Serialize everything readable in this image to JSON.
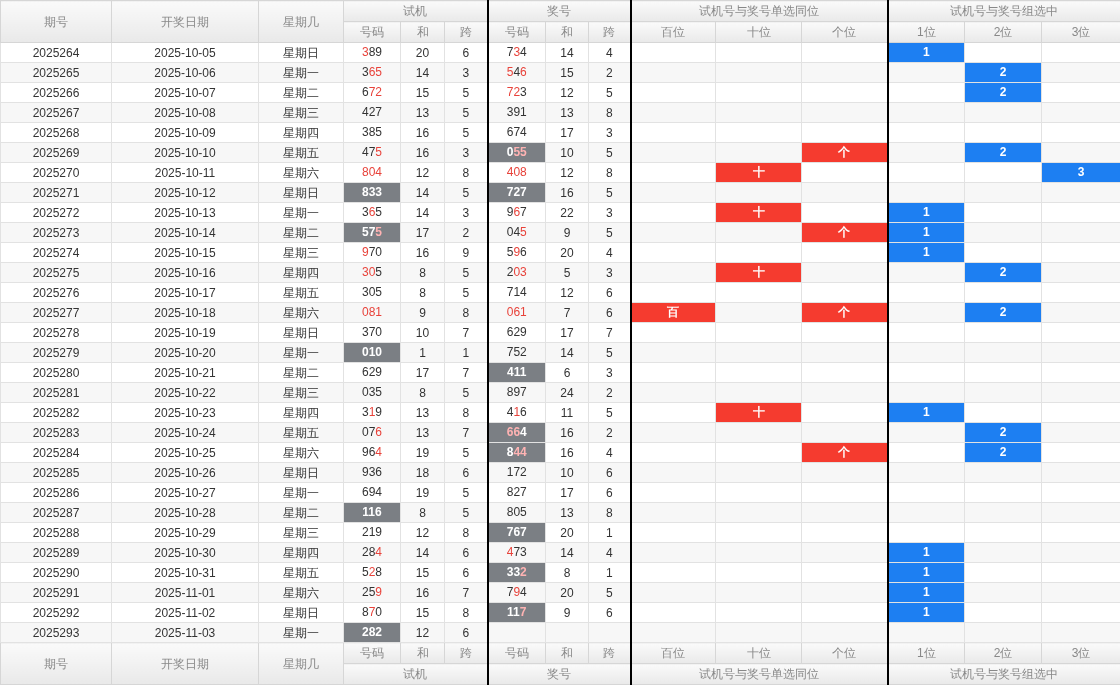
{
  "header": {
    "fixed": [
      "期号",
      "开奖日期",
      "星期几"
    ],
    "groups": [
      {
        "label": "试机",
        "subs": [
          "号码",
          "和",
          "跨"
        ]
      },
      {
        "label": "奖号",
        "subs": [
          "号码",
          "和",
          "跨"
        ]
      },
      {
        "label": "试机号与奖号单选同位",
        "subs": [
          "百位",
          "十位",
          "个位"
        ]
      },
      {
        "label": "试机号与奖号组选中",
        "subs": [
          "1位",
          "2位",
          "3位"
        ]
      }
    ]
  },
  "rows": [
    {
      "period": "2025264",
      "date": "2025-10-05",
      "weekday": "星期日",
      "trial": {
        "digits": [
          "3",
          "8",
          "9"
        ],
        "hits": [
          true,
          false,
          false
        ],
        "highlight": false
      },
      "trial_sum": "20",
      "trial_span": "6",
      "prize": {
        "digits": [
          "7",
          "3",
          "4"
        ],
        "hits": [
          false,
          true,
          false
        ],
        "highlight": false
      },
      "prize_sum": "14",
      "prize_span": "4",
      "group": {
        "first": "1"
      }
    },
    {
      "period": "2025265",
      "date": "2025-10-06",
      "weekday": "星期一",
      "trial": {
        "digits": [
          "3",
          "6",
          "5"
        ],
        "hits": [
          false,
          true,
          true
        ],
        "highlight": false
      },
      "trial_sum": "14",
      "trial_span": "3",
      "prize": {
        "digits": [
          "5",
          "4",
          "6"
        ],
        "hits": [
          true,
          false,
          true
        ],
        "highlight": false
      },
      "prize_sum": "15",
      "prize_span": "2",
      "group": {
        "second": "2"
      }
    },
    {
      "period": "2025266",
      "date": "2025-10-07",
      "weekday": "星期二",
      "trial": {
        "digits": [
          "6",
          "7",
          "2"
        ],
        "hits": [
          false,
          true,
          true
        ],
        "highlight": false
      },
      "trial_sum": "15",
      "trial_span": "5",
      "prize": {
        "digits": [
          "7",
          "2",
          "3"
        ],
        "hits": [
          true,
          true,
          false
        ],
        "highlight": false
      },
      "prize_sum": "12",
      "prize_span": "5",
      "group": {
        "second": "2"
      }
    },
    {
      "period": "2025267",
      "date": "2025-10-08",
      "weekday": "星期三",
      "trial": {
        "digits": [
          "4",
          "2",
          "7"
        ],
        "hits": [
          false,
          false,
          false
        ],
        "highlight": false
      },
      "trial_sum": "13",
      "trial_span": "5",
      "prize": {
        "digits": [
          "3",
          "9",
          "1"
        ],
        "hits": [
          false,
          false,
          false
        ],
        "highlight": false
      },
      "prize_sum": "13",
      "prize_span": "8"
    },
    {
      "period": "2025268",
      "date": "2025-10-09",
      "weekday": "星期四",
      "trial": {
        "digits": [
          "3",
          "8",
          "5"
        ],
        "hits": [
          false,
          false,
          false
        ],
        "highlight": false
      },
      "trial_sum": "16",
      "trial_span": "5",
      "prize": {
        "digits": [
          "6",
          "7",
          "4"
        ],
        "hits": [
          false,
          false,
          false
        ],
        "highlight": false
      },
      "prize_sum": "17",
      "prize_span": "3"
    },
    {
      "period": "2025269",
      "date": "2025-10-10",
      "weekday": "星期五",
      "trial": {
        "digits": [
          "4",
          "7",
          "5"
        ],
        "hits": [
          false,
          false,
          true
        ],
        "highlight": false
      },
      "trial_sum": "16",
      "trial_span": "3",
      "prize": {
        "digits": [
          "0",
          "5",
          "5"
        ],
        "hits": [
          false,
          true,
          true
        ],
        "highlight": true
      },
      "prize_sum": "10",
      "prize_span": "5",
      "single": {
        "ones": "个"
      },
      "group": {
        "second": "2"
      }
    },
    {
      "period": "2025270",
      "date": "2025-10-11",
      "weekday": "星期六",
      "trial": {
        "digits": [
          "8",
          "0",
          "4"
        ],
        "hits": [
          true,
          true,
          true
        ],
        "highlight": false
      },
      "trial_sum": "12",
      "trial_span": "8",
      "prize": {
        "digits": [
          "4",
          "0",
          "8"
        ],
        "hits": [
          true,
          true,
          true
        ],
        "highlight": false
      },
      "prize_sum": "12",
      "prize_span": "8",
      "single": {
        "tens": "十"
      },
      "group": {
        "third": "3"
      }
    },
    {
      "period": "2025271",
      "date": "2025-10-12",
      "weekday": "星期日",
      "trial": {
        "digits": [
          "8",
          "3",
          "3"
        ],
        "hits": [
          false,
          false,
          false
        ],
        "highlight": true
      },
      "trial_sum": "14",
      "trial_span": "5",
      "prize": {
        "digits": [
          "7",
          "2",
          "7"
        ],
        "hits": [
          false,
          false,
          false
        ],
        "highlight": true
      },
      "prize_sum": "16",
      "prize_span": "5"
    },
    {
      "period": "2025272",
      "date": "2025-10-13",
      "weekday": "星期一",
      "trial": {
        "digits": [
          "3",
          "6",
          "5"
        ],
        "hits": [
          false,
          true,
          false
        ],
        "highlight": false
      },
      "trial_sum": "14",
      "trial_span": "3",
      "prize": {
        "digits": [
          "9",
          "6",
          "7"
        ],
        "hits": [
          false,
          true,
          false
        ],
        "highlight": false
      },
      "prize_sum": "22",
      "prize_span": "3",
      "single": {
        "tens": "十"
      },
      "group": {
        "first": "1"
      }
    },
    {
      "period": "2025273",
      "date": "2025-10-14",
      "weekday": "星期二",
      "trial": {
        "digits": [
          "5",
          "7",
          "5"
        ],
        "hits": [
          false,
          false,
          true
        ],
        "highlight": true
      },
      "trial_sum": "17",
      "trial_span": "2",
      "prize": {
        "digits": [
          "0",
          "4",
          "5"
        ],
        "hits": [
          false,
          false,
          true
        ],
        "highlight": false
      },
      "prize_sum": "9",
      "prize_span": "5",
      "single": {
        "ones": "个"
      },
      "group": {
        "first": "1"
      }
    },
    {
      "period": "2025274",
      "date": "2025-10-15",
      "weekday": "星期三",
      "trial": {
        "digits": [
          "9",
          "7",
          "0"
        ],
        "hits": [
          true,
          false,
          false
        ],
        "highlight": false
      },
      "trial_sum": "16",
      "trial_span": "9",
      "prize": {
        "digits": [
          "5",
          "9",
          "6"
        ],
        "hits": [
          false,
          true,
          false
        ],
        "highlight": false
      },
      "prize_sum": "20",
      "prize_span": "4",
      "group": {
        "first": "1"
      }
    },
    {
      "period": "2025275",
      "date": "2025-10-16",
      "weekday": "星期四",
      "trial": {
        "digits": [
          "3",
          "0",
          "5"
        ],
        "hits": [
          true,
          true,
          false
        ],
        "highlight": false
      },
      "trial_sum": "8",
      "trial_span": "5",
      "prize": {
        "digits": [
          "2",
          "0",
          "3"
        ],
        "hits": [
          false,
          true,
          true
        ],
        "highlight": false
      },
      "prize_sum": "5",
      "prize_span": "3",
      "single": {
        "tens": "十"
      },
      "group": {
        "second": "2"
      }
    },
    {
      "period": "2025276",
      "date": "2025-10-17",
      "weekday": "星期五",
      "trial": {
        "digits": [
          "3",
          "0",
          "5"
        ],
        "hits": [
          false,
          false,
          false
        ],
        "highlight": false
      },
      "trial_sum": "8",
      "trial_span": "5",
      "prize": {
        "digits": [
          "7",
          "1",
          "4"
        ],
        "hits": [
          false,
          false,
          false
        ],
        "highlight": false
      },
      "prize_sum": "12",
      "prize_span": "6"
    },
    {
      "period": "2025277",
      "date": "2025-10-18",
      "weekday": "星期六",
      "trial": {
        "digits": [
          "0",
          "8",
          "1"
        ],
        "hits": [
          true,
          true,
          true
        ],
        "highlight": false
      },
      "trial_sum": "9",
      "trial_span": "8",
      "prize": {
        "digits": [
          "0",
          "6",
          "1"
        ],
        "hits": [
          true,
          true,
          true
        ],
        "highlight": false
      },
      "prize_sum": "7",
      "prize_span": "6",
      "single": {
        "hundreds": "百",
        "ones": "个"
      },
      "group": {
        "second": "2"
      }
    },
    {
      "period": "2025278",
      "date": "2025-10-19",
      "weekday": "星期日",
      "trial": {
        "digits": [
          "3",
          "7",
          "0"
        ],
        "hits": [
          false,
          false,
          false
        ],
        "highlight": false
      },
      "trial_sum": "10",
      "trial_span": "7",
      "prize": {
        "digits": [
          "6",
          "2",
          "9"
        ],
        "hits": [
          false,
          false,
          false
        ],
        "highlight": false
      },
      "prize_sum": "17",
      "prize_span": "7"
    },
    {
      "period": "2025279",
      "date": "2025-10-20",
      "weekday": "星期一",
      "trial": {
        "digits": [
          "0",
          "1",
          "0"
        ],
        "hits": [
          false,
          false,
          false
        ],
        "highlight": true
      },
      "trial_sum": "1",
      "trial_span": "1",
      "prize": {
        "digits": [
          "7",
          "5",
          "2"
        ],
        "hits": [
          false,
          false,
          false
        ],
        "highlight": false
      },
      "prize_sum": "14",
      "prize_span": "5"
    },
    {
      "period": "2025280",
      "date": "2025-10-21",
      "weekday": "星期二",
      "trial": {
        "digits": [
          "6",
          "2",
          "9"
        ],
        "hits": [
          false,
          false,
          false
        ],
        "highlight": false
      },
      "trial_sum": "17",
      "trial_span": "7",
      "prize": {
        "digits": [
          "4",
          "1",
          "1"
        ],
        "hits": [
          false,
          false,
          false
        ],
        "highlight": true
      },
      "prize_sum": "6",
      "prize_span": "3"
    },
    {
      "period": "2025281",
      "date": "2025-10-22",
      "weekday": "星期三",
      "trial": {
        "digits": [
          "0",
          "3",
          "5"
        ],
        "hits": [
          false,
          false,
          false
        ],
        "highlight": false
      },
      "trial_sum": "8",
      "trial_span": "5",
      "prize": {
        "digits": [
          "8",
          "9",
          "7"
        ],
        "hits": [
          false,
          false,
          false
        ],
        "highlight": false
      },
      "prize_sum": "24",
      "prize_span": "2"
    },
    {
      "period": "2025282",
      "date": "2025-10-23",
      "weekday": "星期四",
      "trial": {
        "digits": [
          "3",
          "1",
          "9"
        ],
        "hits": [
          false,
          true,
          false
        ],
        "highlight": false
      },
      "trial_sum": "13",
      "trial_span": "8",
      "prize": {
        "digits": [
          "4",
          "1",
          "6"
        ],
        "hits": [
          false,
          true,
          false
        ],
        "highlight": false
      },
      "prize_sum": "11",
      "prize_span": "5",
      "single": {
        "tens": "十"
      },
      "group": {
        "first": "1"
      }
    },
    {
      "period": "2025283",
      "date": "2025-10-24",
      "weekday": "星期五",
      "trial": {
        "digits": [
          "0",
          "7",
          "6"
        ],
        "hits": [
          false,
          false,
          true
        ],
        "highlight": false
      },
      "trial_sum": "13",
      "trial_span": "7",
      "prize": {
        "digits": [
          "6",
          "6",
          "4"
        ],
        "hits": [
          true,
          true,
          false
        ],
        "highlight": true
      },
      "prize_sum": "16",
      "prize_span": "2",
      "group": {
        "second": "2"
      }
    },
    {
      "period": "2025284",
      "date": "2025-10-25",
      "weekday": "星期六",
      "trial": {
        "digits": [
          "9",
          "6",
          "4"
        ],
        "hits": [
          false,
          false,
          true
        ],
        "highlight": false
      },
      "trial_sum": "19",
      "trial_span": "5",
      "prize": {
        "digits": [
          "8",
          "4",
          "4"
        ],
        "hits": [
          false,
          true,
          true
        ],
        "highlight": true
      },
      "prize_sum": "16",
      "prize_span": "4",
      "single": {
        "ones": "个"
      },
      "group": {
        "second": "2"
      }
    },
    {
      "period": "2025285",
      "date": "2025-10-26",
      "weekday": "星期日",
      "trial": {
        "digits": [
          "9",
          "3",
          "6"
        ],
        "hits": [
          false,
          false,
          false
        ],
        "highlight": false
      },
      "trial_sum": "18",
      "trial_span": "6",
      "prize": {
        "digits": [
          "1",
          "7",
          "2"
        ],
        "hits": [
          false,
          false,
          false
        ],
        "highlight": false
      },
      "prize_sum": "10",
      "prize_span": "6"
    },
    {
      "period": "2025286",
      "date": "2025-10-27",
      "weekday": "星期一",
      "trial": {
        "digits": [
          "6",
          "9",
          "4"
        ],
        "hits": [
          false,
          false,
          false
        ],
        "highlight": false
      },
      "trial_sum": "19",
      "trial_span": "5",
      "prize": {
        "digits": [
          "8",
          "2",
          "7"
        ],
        "hits": [
          false,
          false,
          false
        ],
        "highlight": false
      },
      "prize_sum": "17",
      "prize_span": "6"
    },
    {
      "period": "2025287",
      "date": "2025-10-28",
      "weekday": "星期二",
      "trial": {
        "digits": [
          "1",
          "1",
          "6"
        ],
        "hits": [
          false,
          false,
          false
        ],
        "highlight": true
      },
      "trial_sum": "8",
      "trial_span": "5",
      "prize": {
        "digits": [
          "8",
          "0",
          "5"
        ],
        "hits": [
          false,
          false,
          false
        ],
        "highlight": false
      },
      "prize_sum": "13",
      "prize_span": "8"
    },
    {
      "period": "2025288",
      "date": "2025-10-29",
      "weekday": "星期三",
      "trial": {
        "digits": [
          "2",
          "1",
          "9"
        ],
        "hits": [
          false,
          false,
          false
        ],
        "highlight": false
      },
      "trial_sum": "12",
      "trial_span": "8",
      "prize": {
        "digits": [
          "7",
          "6",
          "7"
        ],
        "hits": [
          false,
          false,
          false
        ],
        "highlight": true
      },
      "prize_sum": "20",
      "prize_span": "1"
    },
    {
      "period": "2025289",
      "date": "2025-10-30",
      "weekday": "星期四",
      "trial": {
        "digits": [
          "2",
          "8",
          "4"
        ],
        "hits": [
          false,
          false,
          true
        ],
        "highlight": false
      },
      "trial_sum": "14",
      "trial_span": "6",
      "prize": {
        "digits": [
          "4",
          "7",
          "3"
        ],
        "hits": [
          true,
          false,
          false
        ],
        "highlight": false
      },
      "prize_sum": "14",
      "prize_span": "4",
      "group": {
        "first": "1"
      }
    },
    {
      "period": "2025290",
      "date": "2025-10-31",
      "weekday": "星期五",
      "trial": {
        "digits": [
          "5",
          "2",
          "8"
        ],
        "hits": [
          false,
          true,
          false
        ],
        "highlight": false
      },
      "trial_sum": "15",
      "trial_span": "6",
      "prize": {
        "digits": [
          "3",
          "3",
          "2"
        ],
        "hits": [
          false,
          false,
          true
        ],
        "highlight": true
      },
      "prize_sum": "8",
      "prize_span": "1",
      "group": {
        "first": "1"
      }
    },
    {
      "period": "2025291",
      "date": "2025-11-01",
      "weekday": "星期六",
      "trial": {
        "digits": [
          "2",
          "5",
          "9"
        ],
        "hits": [
          false,
          false,
          true
        ],
        "highlight": false
      },
      "trial_sum": "16",
      "trial_span": "7",
      "prize": {
        "digits": [
          "7",
          "9",
          "4"
        ],
        "hits": [
          false,
          true,
          false
        ],
        "highlight": false
      },
      "prize_sum": "20",
      "prize_span": "5",
      "group": {
        "first": "1"
      }
    },
    {
      "period": "2025292",
      "date": "2025-11-02",
      "weekday": "星期日",
      "trial": {
        "digits": [
          "8",
          "7",
          "0"
        ],
        "hits": [
          false,
          true,
          false
        ],
        "highlight": false
      },
      "trial_sum": "15",
      "trial_span": "8",
      "prize": {
        "digits": [
          "1",
          "1",
          "7"
        ],
        "hits": [
          false,
          false,
          true
        ],
        "highlight": true
      },
      "prize_sum": "9",
      "prize_span": "6",
      "group": {
        "first": "1"
      }
    },
    {
      "period": "2025293",
      "date": "2025-11-03",
      "weekday": "星期一",
      "trial": {
        "digits": [
          "2",
          "8",
          "2"
        ],
        "hits": [
          false,
          false,
          false
        ],
        "highlight": true
      },
      "trial_sum": "12",
      "trial_span": "6"
    }
  ],
  "footer": {
    "fixed": [
      "期号",
      "开奖日期",
      "星期几"
    ],
    "groups": [
      {
        "label": "试机",
        "subs": [
          "号码",
          "和",
          "跨"
        ]
      },
      {
        "label": "奖号",
        "subs": [
          "号码",
          "和",
          "跨"
        ]
      },
      {
        "label": "试机号与奖号单选同位",
        "subs": [
          "百位",
          "十位",
          "个位"
        ]
      },
      {
        "label": "试机号与奖号组选中",
        "subs": [
          "1位",
          "2位",
          "3位"
        ]
      }
    ]
  }
}
